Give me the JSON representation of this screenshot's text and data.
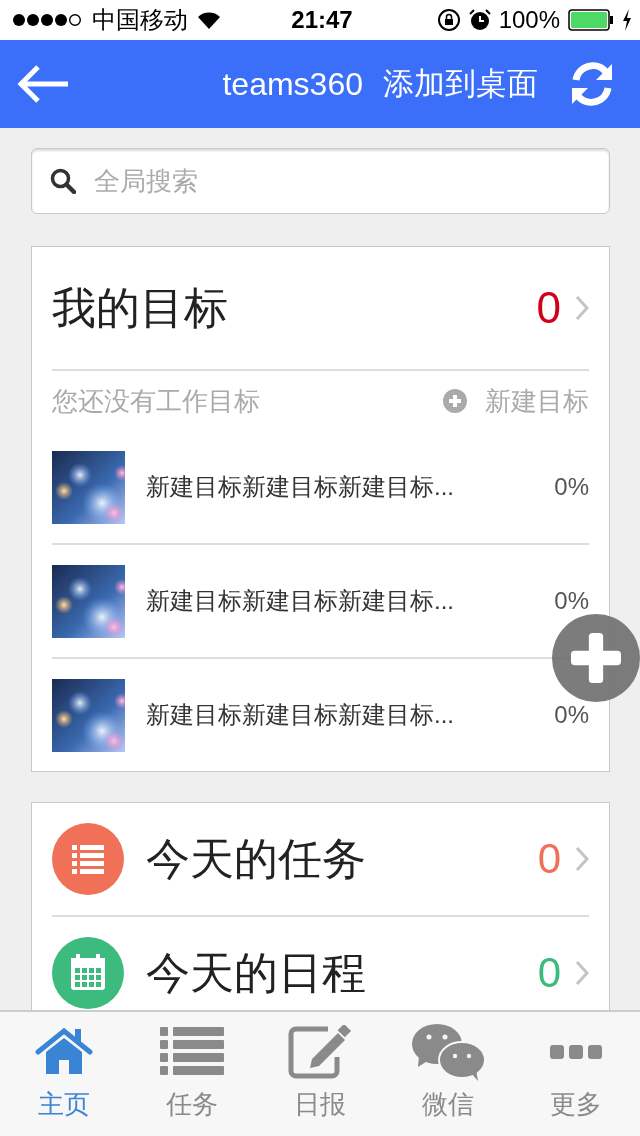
{
  "status_bar": {
    "carrier": "中国移动",
    "time": "21:47",
    "battery": "100%"
  },
  "header": {
    "title": "teams360",
    "action": "添加到桌面"
  },
  "search": {
    "placeholder": "全局搜索"
  },
  "goals": {
    "title": "我的目标",
    "count": "0",
    "empty_text": "您还没有工作目标",
    "new_label": "新建目标",
    "items": [
      {
        "title": "新建目标新建目标新建目标...",
        "progress": "0%",
        "kind": "picture"
      },
      {
        "title": "新建目标新建目标新建目标...",
        "progress": "0%",
        "kind": "picture"
      },
      {
        "title": "新建目标新建目标新建目标...",
        "progress": "0%",
        "kind": "picture"
      }
    ]
  },
  "summary": [
    {
      "kind": "tasks",
      "label": "今天的任务",
      "count": "0",
      "color": "#f07058"
    },
    {
      "kind": "schedule",
      "label": "今天的日程",
      "count": "0",
      "color": "#3dba7e"
    }
  ],
  "tabs": [
    {
      "kind": "home",
      "label": "主页",
      "selected": true
    },
    {
      "kind": "tasks",
      "label": "任务",
      "selected": false
    },
    {
      "kind": "report",
      "label": "日报",
      "selected": false
    },
    {
      "kind": "wechat",
      "label": "微信",
      "selected": false
    },
    {
      "kind": "more",
      "label": "更多",
      "selected": false
    }
  ]
}
